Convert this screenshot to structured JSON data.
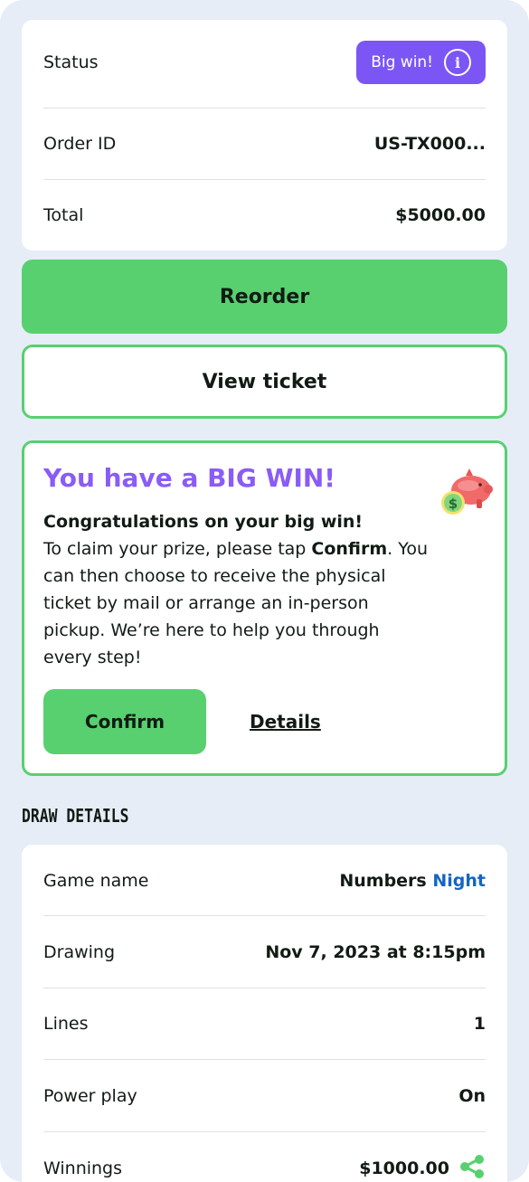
{
  "order": {
    "status_label": "Status",
    "status_badge": "Big win!",
    "order_id_label": "Order ID",
    "order_id_value": "US-TX000...",
    "total_label": "Total",
    "total_value": "$5000.00"
  },
  "actions": {
    "reorder_label": "Reorder",
    "view_ticket_label": "View ticket"
  },
  "win": {
    "title": "You have a BIG WIN!",
    "headline": "Congratulations on your big win!",
    "text_before": "To claim your prize, please tap ",
    "text_bold": "Confirm",
    "text_after": ". You can then choose to receive the physical ticket by mail or arrange an in-person pickup. We’re here to help you through every step!",
    "confirm_label": "Confirm",
    "details_label": "Details",
    "icon": "piggy-bank-icon"
  },
  "draw": {
    "section_title": "DRAW DETAILS",
    "game_label": "Game name",
    "game_value_a": "Numbers",
    "game_value_b": "Night",
    "drawing_label": "Drawing",
    "drawing_value": "Nov 7, 2023 at 8:15pm",
    "lines_label": "Lines",
    "lines_value": "1",
    "powerplay_label": "Power play",
    "powerplay_value": "On",
    "winnings_label": "Winnings",
    "winnings_value": "$1000.00"
  },
  "colors": {
    "accent_green": "#58d070",
    "badge_purple": "#7b56f5",
    "title_purple": "#8a5cf6",
    "link_blue": "#1565c0",
    "background": "#e6edf6"
  }
}
